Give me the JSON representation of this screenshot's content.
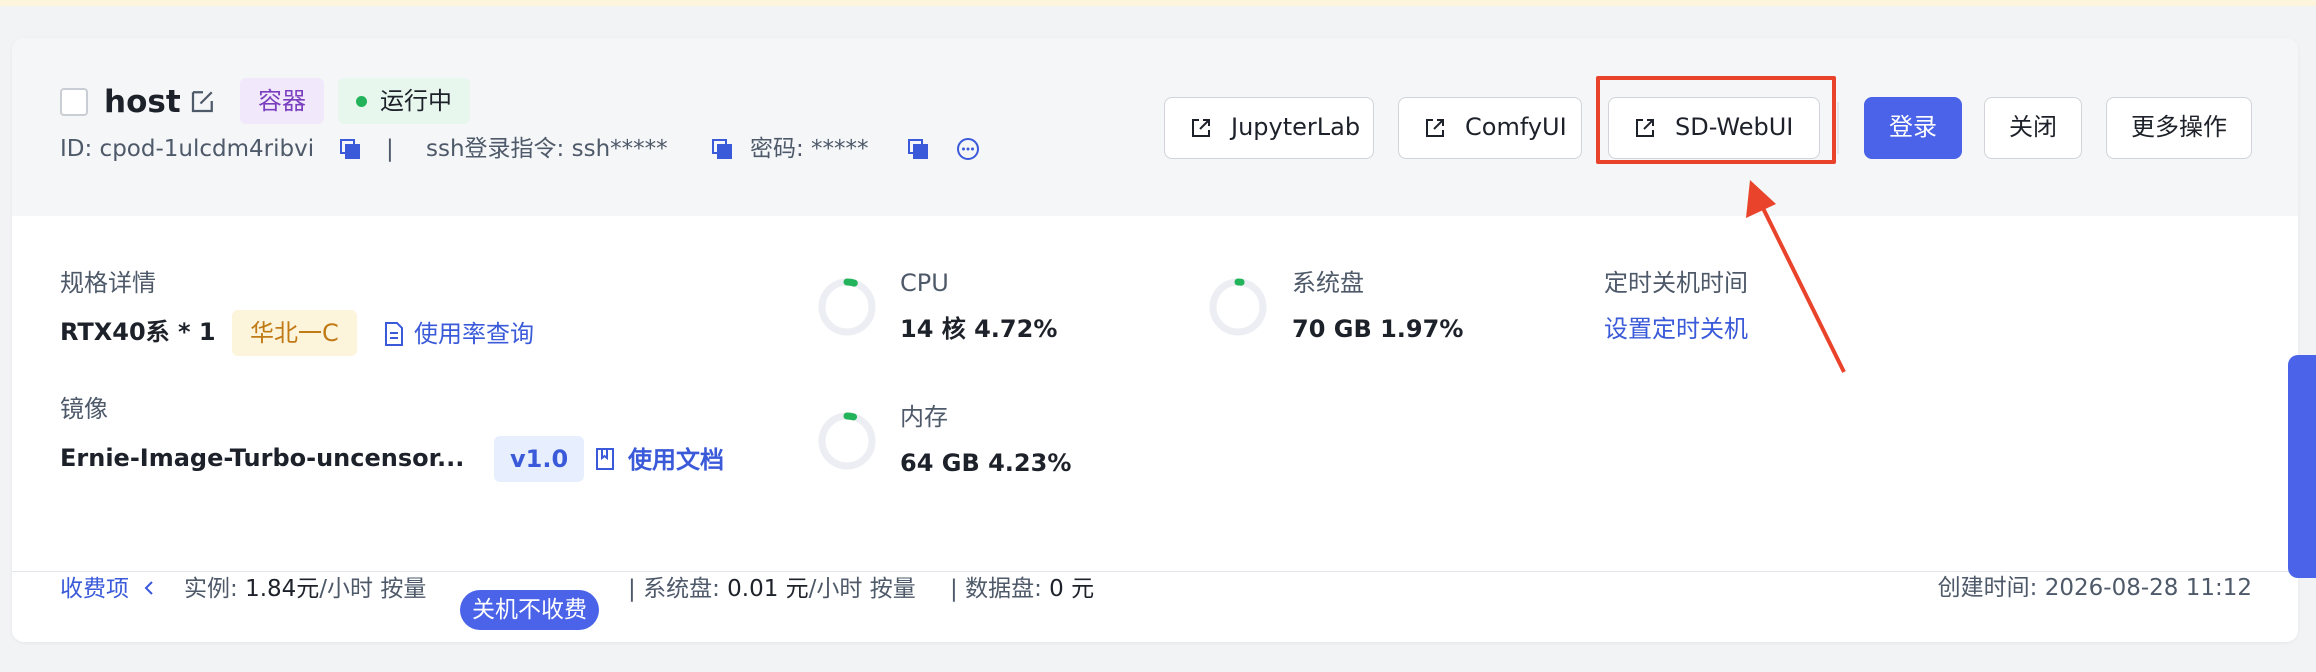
{
  "instance": {
    "name": "host",
    "type_tag": "容器",
    "status": "运行中",
    "id_text": "ID: cpod-1ulcdm4ribvi",
    "separator": "|",
    "ssh_text": "ssh登录指令: ssh*****",
    "password_text": "密码: *****"
  },
  "actions": {
    "jupyterlab": "JupyterLab",
    "comfyui": "ComfyUI",
    "sdwebui": "SD-WebUI",
    "login": "登录",
    "close": "关闭",
    "more": "更多操作"
  },
  "spec": {
    "label": "规格详情",
    "gpu": "RTX40系 * 1",
    "region": "华北一C",
    "usage_link": "使用率查询"
  },
  "image": {
    "label": "镜像",
    "name": "Ernie-Image-Turbo-uncensor...",
    "version": "v1.0",
    "doc_link": "使用文档"
  },
  "metrics": {
    "cpu": {
      "label": "CPU",
      "value": "14 核 4.72%",
      "percent": 4.72
    },
    "memory": {
      "label": "内存",
      "value": "64 GB 4.23%",
      "percent": 4.23
    },
    "disk": {
      "label": "系统盘",
      "value": "70 GB 1.97%",
      "percent": 1.97
    }
  },
  "shutdown": {
    "label": "定时关机时间",
    "link": "设置定时关机"
  },
  "footer": {
    "fee_toggle": "收费项",
    "instance_label": "实例:",
    "instance_price": "1.84元",
    "instance_unit": "/小时 按量",
    "free_when_off": "关机不收费",
    "sep": "|",
    "sysdisk_label": "系统盘:",
    "sysdisk_price": "0.01 元",
    "sysdisk_unit": "/小时 按量",
    "datadisk_label": "数据盘:",
    "datadisk_price": "0 元",
    "created": "创建时间: 2026-08-28 11:12"
  },
  "colors": {
    "primary": "#4a63e8",
    "highlight": "#e9442b",
    "running": "#23b35a"
  }
}
